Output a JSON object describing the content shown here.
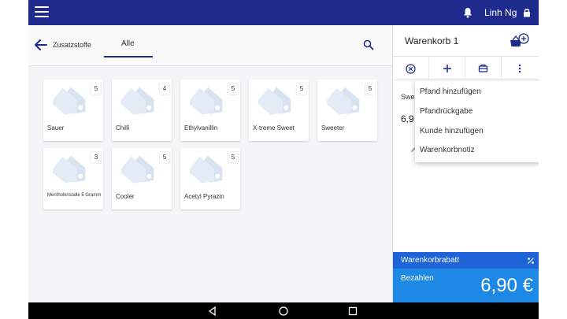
{
  "topbar": {
    "user_name": "Linh Ng",
    "menu_icon": "hamburger-menu-icon",
    "bell_icon": "bell-icon",
    "lock_icon": "lock-icon"
  },
  "subnav": {
    "back_label": "Zusatzstoffe",
    "tab_label": "Alle"
  },
  "products": [
    {
      "name": "Sauer",
      "count": "5"
    },
    {
      "name": "Chilli",
      "count": "4"
    },
    {
      "name": "Ethylvanillin",
      "count": "5"
    },
    {
      "name": "X-treme Sweet",
      "count": "5"
    },
    {
      "name": "Sweeter",
      "count": "5"
    },
    {
      "name": "Mentholkristalle 5 Gramm",
      "count": "3"
    },
    {
      "name": "Cooler",
      "count": "5"
    },
    {
      "name": "Acetyl Pyrazin",
      "count": "5"
    }
  ],
  "cart": {
    "title": "Warenkorb 1",
    "item_peek": "Swe",
    "price_peek": "6,9",
    "menu_items": [
      "Pfand hinzufügen",
      "Pfandrückgabe",
      "Kunde hinzufügen",
      "Warenkorbnotiz"
    ],
    "discount_label": "Warenkorbrabatt",
    "pay_label": "Bezahlen",
    "total": "6,90 €"
  },
  "colors": {
    "topbar": "#1e2a8c",
    "discount": "#1e63d8",
    "pay": "#1e88e5"
  }
}
